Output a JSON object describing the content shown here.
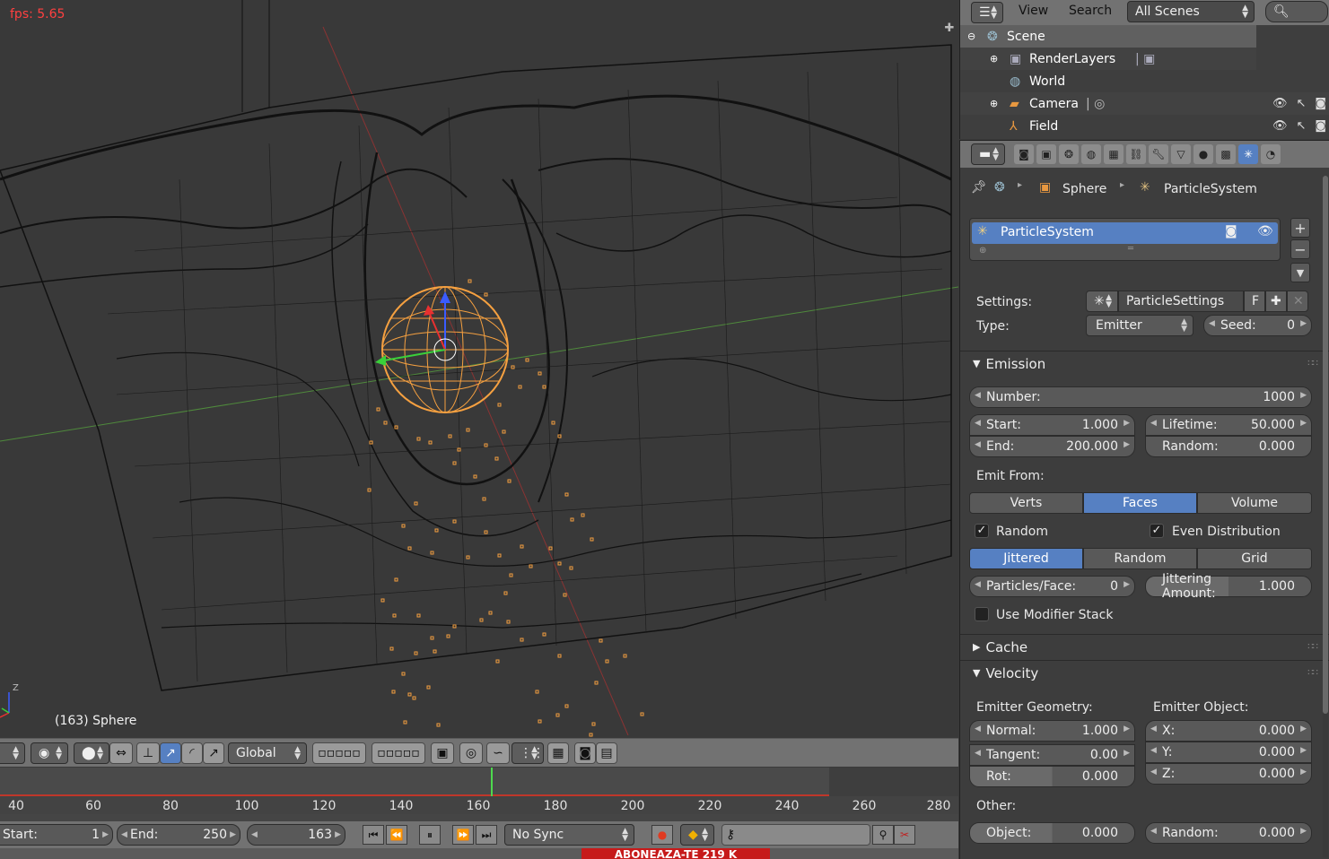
{
  "viewport": {
    "fps_label": "fps: 5.65",
    "object_label": "(163) Sphere",
    "axis_z_label": "Z"
  },
  "view_header": {
    "orientation": "Global"
  },
  "timeline": {
    "ticks": [
      "40",
      "60",
      "80",
      "100",
      "120",
      "140",
      "160",
      "180",
      "200",
      "220",
      "240",
      "260",
      "280"
    ],
    "current_frame": "163",
    "start_label": "Start:",
    "start_value": "1",
    "end_label": "End:",
    "end_value": "250",
    "sync": "No Sync"
  },
  "status_bar": {
    "banner": "ABONEAZA-TE  219 K"
  },
  "outliner": {
    "menu": [
      "View",
      "Search"
    ],
    "scene_select": "All Scenes",
    "rows": [
      {
        "label": "Scene"
      },
      {
        "label": "RenderLayers"
      },
      {
        "label": "World"
      },
      {
        "label": "Camera"
      },
      {
        "label": "Field"
      }
    ]
  },
  "properties": {
    "breadcrumb": {
      "object": "Sphere",
      "system": "ParticleSystem"
    },
    "list_item": "ParticleSystem",
    "settings_label": "Settings:",
    "settings_value": "ParticleSettings",
    "settings_f": "F",
    "type_label": "Type:",
    "type_value": "Emitter",
    "seed_label": "Seed:",
    "seed_value": "0",
    "emission": {
      "title": "Emission",
      "number_label": "Number:",
      "number_value": "1000",
      "start_label": "Start:",
      "start_value": "1.000",
      "end_label": "End:",
      "end_value": "200.000",
      "lifetime_label": "Lifetime:",
      "lifetime_value": "50.000",
      "random_label": "Random:",
      "random_value": "0.000",
      "emit_from_label": "Emit From:",
      "emit_from_options": [
        "Verts",
        "Faces",
        "Volume"
      ],
      "random_check": "Random",
      "even_check": "Even Distribution",
      "dist_options": [
        "Jittered",
        "Random",
        "Grid"
      ],
      "ppf_label": "Particles/Face:",
      "ppf_value": "0",
      "jitter_label": "Jittering Amount:",
      "jitter_value": "1.000",
      "modifier_stack": "Use Modifier Stack"
    },
    "cache": {
      "title": "Cache"
    },
    "velocity": {
      "title": "Velocity",
      "emitter_geometry": "Emitter Geometry:",
      "emitter_object": "Emitter Object:",
      "normal_label": "Normal:",
      "normal_value": "1.000",
      "tangent_label": "Tangent:",
      "tangent_value": "0.00",
      "rot_label": "Rot:",
      "rot_value": "0.000",
      "x_label": "X:",
      "x_value": "0.000",
      "y_label": "Y:",
      "y_value": "0.000",
      "z_label": "Z:",
      "z_value": "0.000",
      "other_label": "Other:",
      "object_label": "Object:",
      "object_value": "0.000",
      "random_label": "Random:",
      "random_value": "0.000"
    }
  },
  "colors": {
    "accent": "#5680c2",
    "selection": "#f5a040",
    "fps": "#ff4040",
    "frame_cursor": "#4ed84e"
  }
}
